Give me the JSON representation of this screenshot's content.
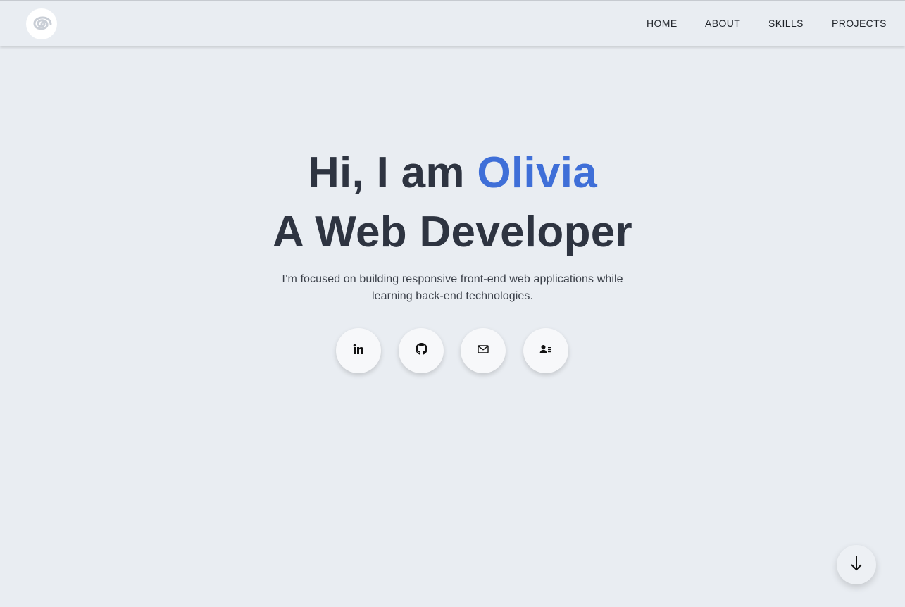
{
  "nav": {
    "logo_icon": "spiral-logo-icon",
    "items": [
      {
        "label": "HOME"
      },
      {
        "label": "ABOUT"
      },
      {
        "label": "SKILLS"
      },
      {
        "label": "PROJECTS"
      }
    ]
  },
  "hero": {
    "greeting_prefix": "Hi, I am ",
    "name": "Olivia",
    "role": "A Web Developer",
    "description": "I’m focused on building responsive front-end web applications while learning back-end technologies.",
    "social_links": [
      {
        "icon": "linkedin-icon"
      },
      {
        "icon": "github-icon"
      },
      {
        "icon": "email-icon"
      },
      {
        "icon": "contact-card-icon"
      }
    ],
    "scroll_icon": "arrow-down-icon"
  },
  "colors": {
    "background": "#e9edf2",
    "accent": "#3f6fd8",
    "heading": "#2e3441"
  }
}
